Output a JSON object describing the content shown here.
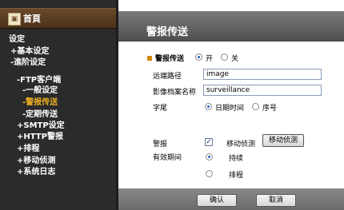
{
  "sidebar": {
    "home_icon": "home-icon",
    "home_label": "首頁",
    "items": [
      {
        "label": "设定",
        "active": false
      },
      {
        "label": "+基本设定",
        "active": false
      },
      {
        "label": "-進阶设定",
        "active": false
      },
      {
        "label": "-FTP客户端",
        "active": false
      },
      {
        "label": "-一般设定",
        "active": false
      },
      {
        "label": "-警报传送",
        "active": true
      },
      {
        "label": "-定期传送",
        "active": false
      },
      {
        "label": "+SMTP设定",
        "active": false
      },
      {
        "label": "+HTTP警报",
        "active": false
      },
      {
        "label": "+排程",
        "active": false
      },
      {
        "label": "+移动侦测",
        "active": false
      },
      {
        "label": "+系统日志",
        "active": false
      }
    ]
  },
  "main": {
    "title": "警报传送",
    "alarm_send": {
      "label": "警报传送",
      "on_label": "开",
      "off_label": "关",
      "selected": "on"
    },
    "remote_path": {
      "label": "远端路径",
      "value": "image"
    },
    "image_name": {
      "label": "影像档案名称",
      "value": "surveillance"
    },
    "suffix": {
      "label": "字尾",
      "option_datetime": "日期时间",
      "option_seq": "序号",
      "selected": "datetime"
    },
    "alarm": {
      "label": "警报",
      "motion_label": "移动侦测",
      "motion_checked": true,
      "motion_button": "移动侦测"
    },
    "duration": {
      "label": "有效期间",
      "option_continuous": "持续",
      "option_schedule": "排程",
      "selected": "continuous"
    },
    "ok_button": "确认",
    "cancel_button": "取消"
  },
  "colors": {
    "accent": "#f0b020",
    "bullet": "#d48a10",
    "sidebar_bg": "#2b2b2b",
    "title_bar": "#5e5e5e"
  }
}
